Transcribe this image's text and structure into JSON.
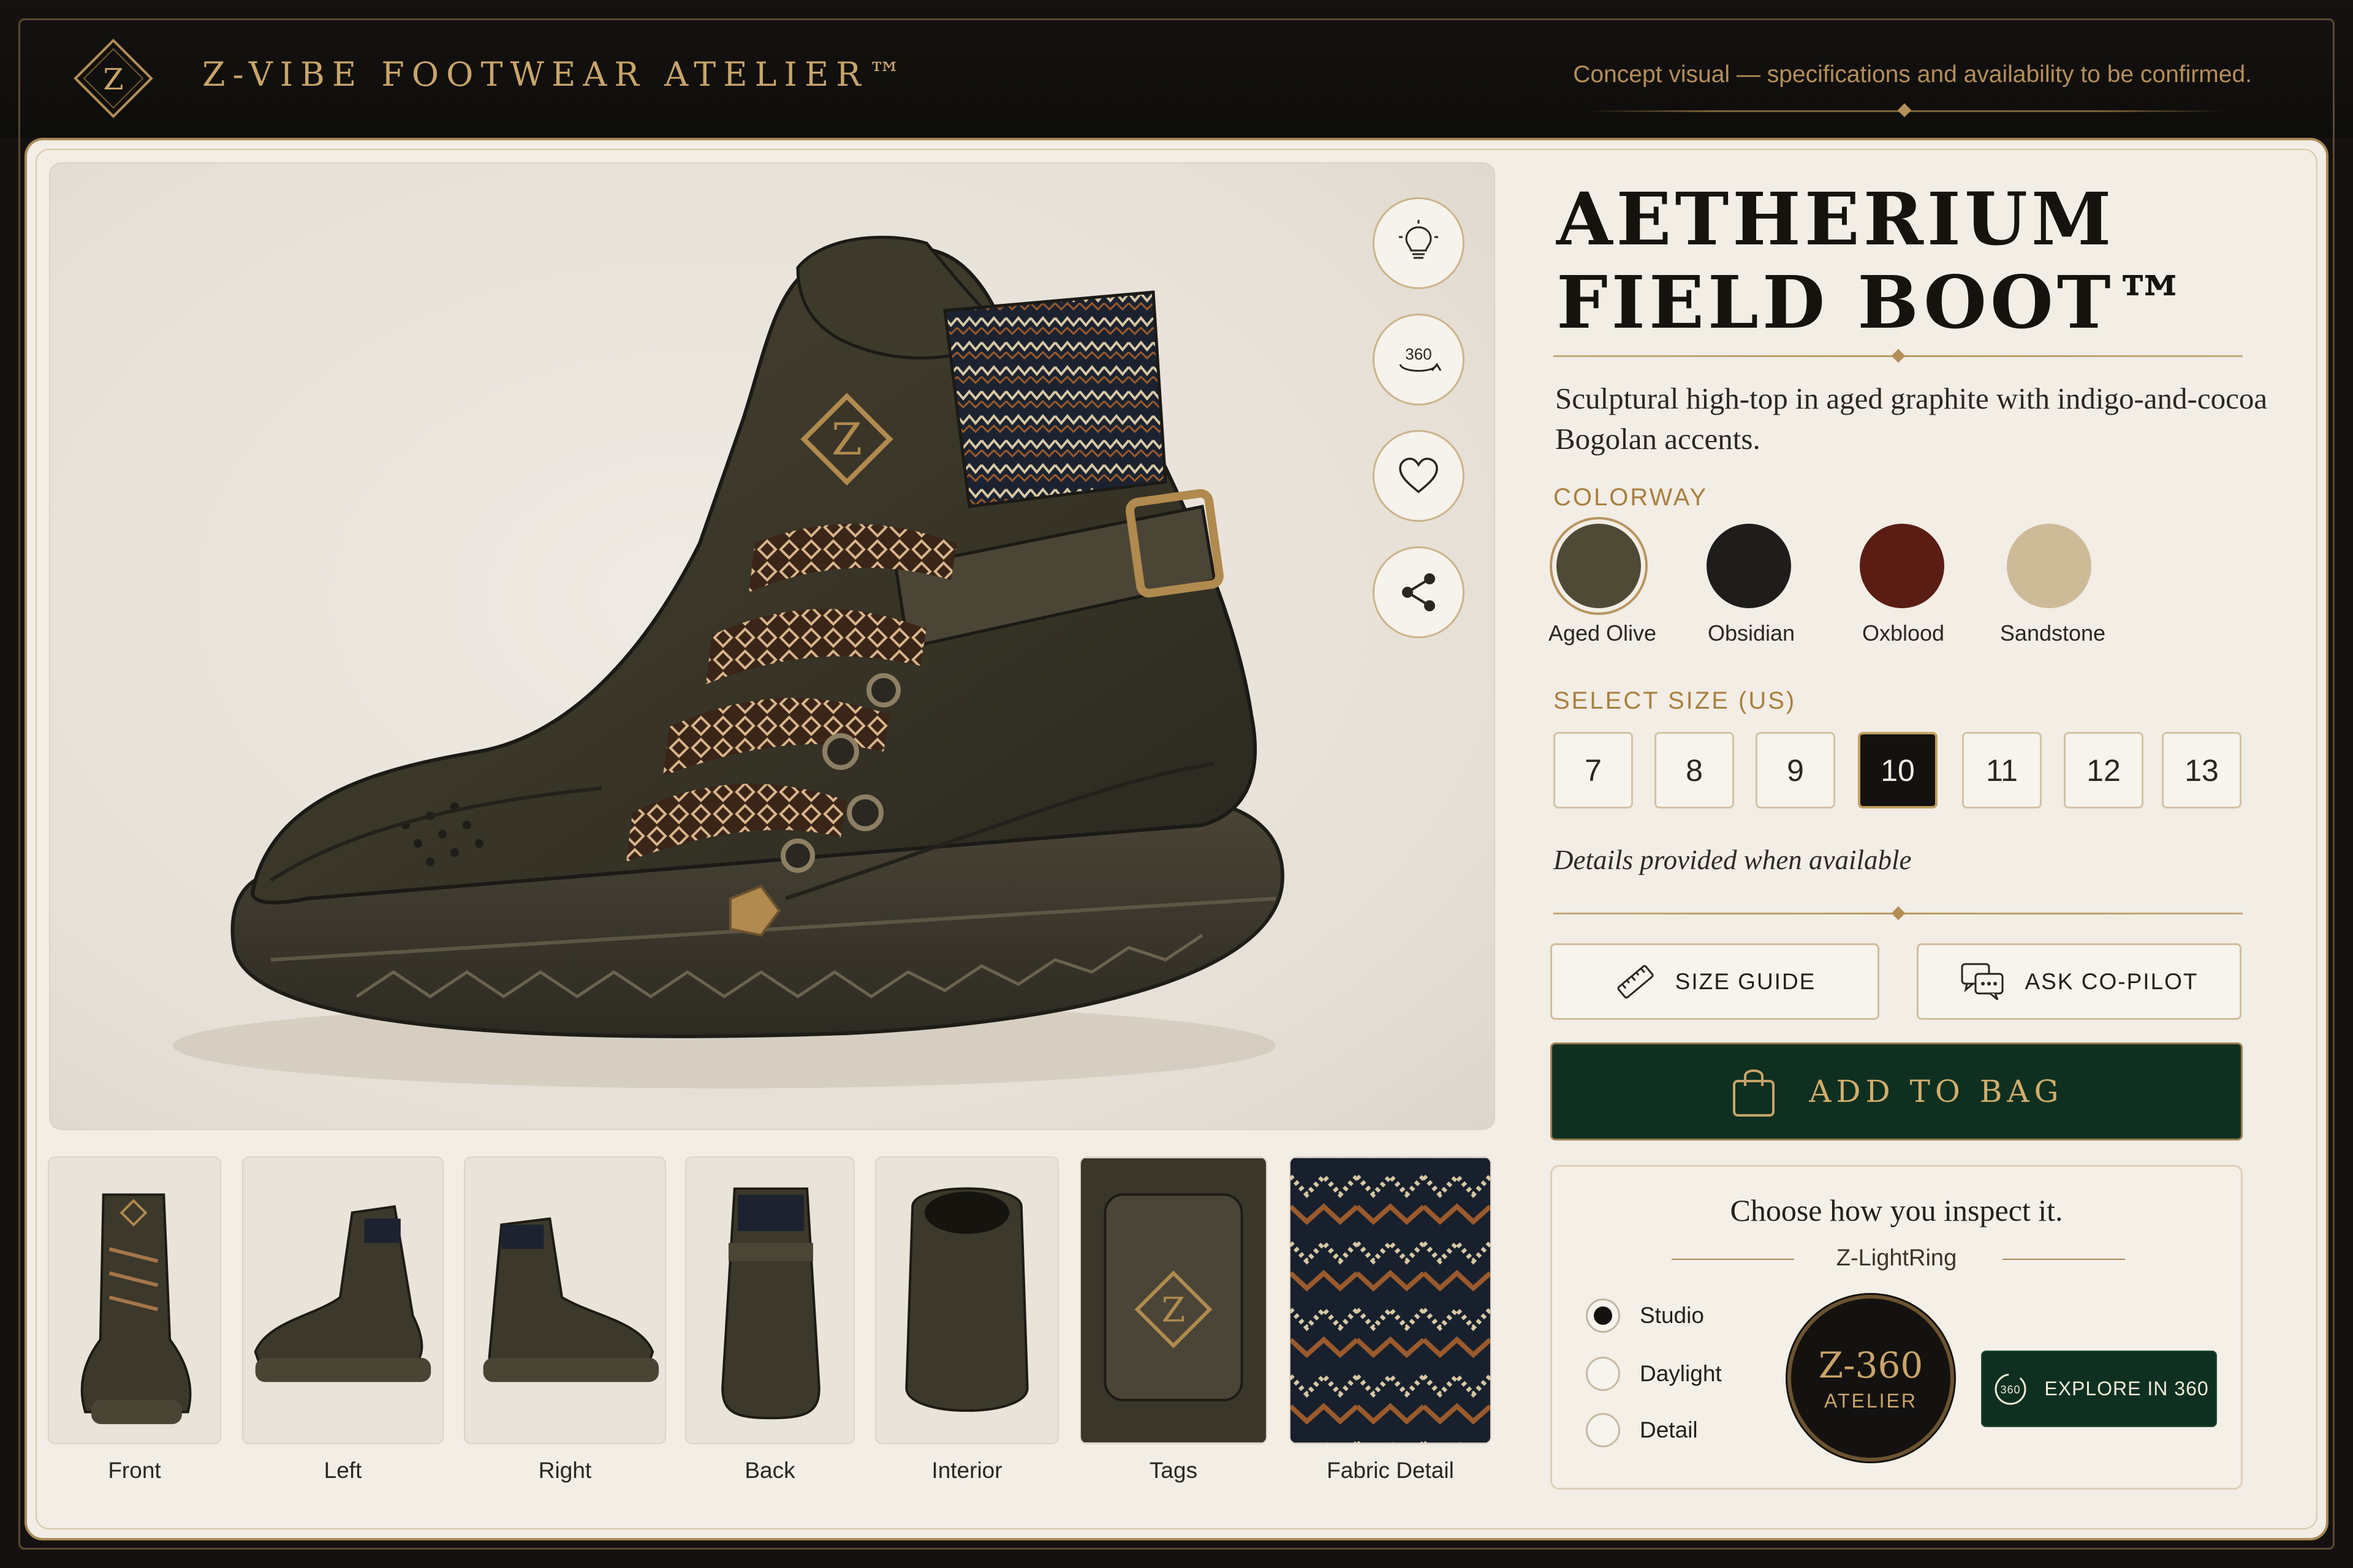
{
  "header": {
    "logo_letter": "Z",
    "brand": "Z-VIBE FOOTWEAR ATELIER™",
    "disclaimer": "Concept visual — specifications and availability to be confirmed."
  },
  "product": {
    "title_line1": "AETHERIUM",
    "title_line2": "FIELD BOOT™",
    "description": "Sculptural high-top in aged graphite with indigo-and-cocoa Bogolan accents.",
    "details_note": "Details provided when available"
  },
  "viewer": {
    "actions": [
      {
        "name": "lightbulb-icon",
        "label": ""
      },
      {
        "name": "rotate-360-icon",
        "label": "360"
      },
      {
        "name": "heart-icon",
        "label": ""
      },
      {
        "name": "share-icon",
        "label": ""
      }
    ],
    "boot_logo_letter": "Z"
  },
  "thumbnails": [
    {
      "label": "Front"
    },
    {
      "label": "Left"
    },
    {
      "label": "Right"
    },
    {
      "label": "Back"
    },
    {
      "label": "Interior"
    },
    {
      "label": "Tags"
    },
    {
      "label": "Fabric Detail"
    }
  ],
  "colorway": {
    "label": "COLORWAY",
    "options": [
      {
        "label": "Aged Olive",
        "color": "#4d4a36",
        "selected": true
      },
      {
        "label": "Obsidian",
        "color": "#1e1d1b",
        "selected": false
      },
      {
        "label": "Oxblood",
        "color": "#5a1d14",
        "selected": false
      },
      {
        "label": "Sandstone",
        "color": "#cdbb98",
        "selected": false
      }
    ]
  },
  "sizes": {
    "label": "SELECT SIZE (US)",
    "options": [
      "7",
      "8",
      "9",
      "10",
      "11",
      "12",
      "13"
    ],
    "selected": "10"
  },
  "buttons": {
    "size_guide": "SIZE GUIDE",
    "ask_copilot": "ASK CO-PILOT",
    "add_to_bag": "ADD TO BAG"
  },
  "inspect": {
    "title": "Choose how you inspect it.",
    "subtitle": "Z-LightRing",
    "modes": [
      {
        "label": "Studio",
        "selected": true
      },
      {
        "label": "Daylight",
        "selected": false
      },
      {
        "label": "Detail",
        "selected": false
      }
    ],
    "badge_big": "Z-360",
    "badge_small": "ATELIER",
    "explore_label": "EXPLORE IN 360",
    "explore_icon_text": "360"
  },
  "colors": {
    "gold": "#c9a46a",
    "dark_green": "#0f3020",
    "panel": "#f2ede5",
    "ink": "#141210"
  }
}
